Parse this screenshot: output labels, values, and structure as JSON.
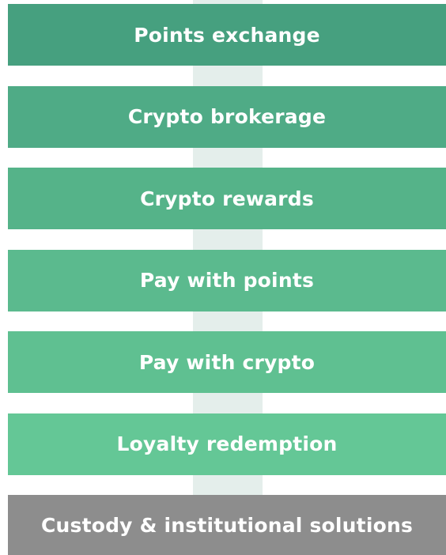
{
  "layers": [
    {
      "label": "Points exchange"
    },
    {
      "label": "Crypto brokerage"
    },
    {
      "label": "Crypto rewards"
    },
    {
      "label": "Pay with points"
    },
    {
      "label": "Pay with crypto"
    },
    {
      "label": "Loyalty redemption"
    },
    {
      "label": "Custody & institutional solutions"
    }
  ],
  "colors": {
    "layer_1": "#46a07f",
    "layer_2": "#4fab86",
    "layer_3": "#55b389",
    "layer_4": "#5bba8e",
    "layer_5": "#5fc091",
    "layer_6": "#64c796",
    "foundation": "#8d8d8d",
    "spine": "#e4eeeb"
  }
}
